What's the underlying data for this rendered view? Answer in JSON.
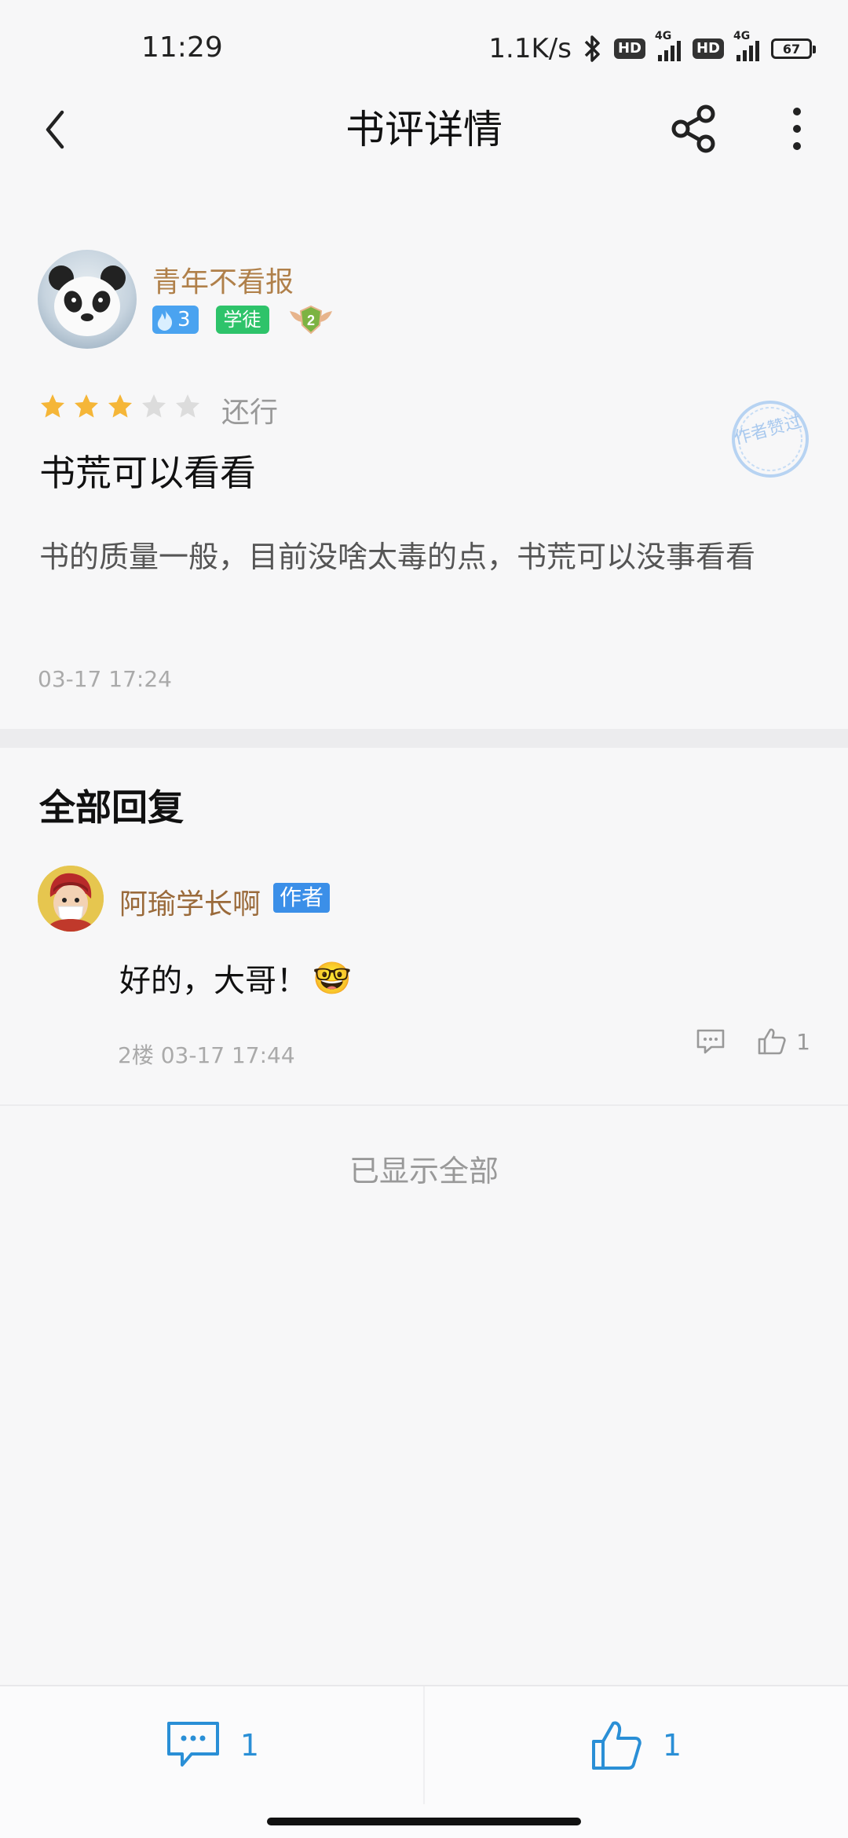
{
  "status_bar": {
    "time": "11:29",
    "network_speed": "1.1K/s",
    "hd_label": "HD",
    "network_type": "4G",
    "battery": "67"
  },
  "app_bar": {
    "title": "书评详情",
    "icons": [
      "back-icon",
      "share-icon",
      "more-vertical-icon"
    ]
  },
  "review": {
    "author": "青年不看报",
    "fire_level": "3",
    "rank_label": "学徒",
    "medal_level": "2",
    "rating": 3,
    "rating_max": 5,
    "rating_text": "还行",
    "stamp_text": "作者赞过",
    "title": "书荒可以看看",
    "body": "书的质量一般，目前没啥太毒的点，书荒可以没事看看",
    "time": "03-17 17:24"
  },
  "replies": {
    "section_title": "全部回复",
    "items": [
      {
        "author": "阿瑜学长啊",
        "tag": "作者",
        "text": "好的，大哥！",
        "emoji": "🤓",
        "meta": "2楼 03-17 17:44",
        "likes": "1"
      }
    ],
    "end_text": "已显示全部"
  },
  "bottom_bar": {
    "comment_count": "1",
    "like_count": "1"
  },
  "colors": {
    "accent": "#2a8fd6",
    "username": "#b0804a",
    "star_active": "#f5b638",
    "star_inactive": "#dcdcdc"
  }
}
